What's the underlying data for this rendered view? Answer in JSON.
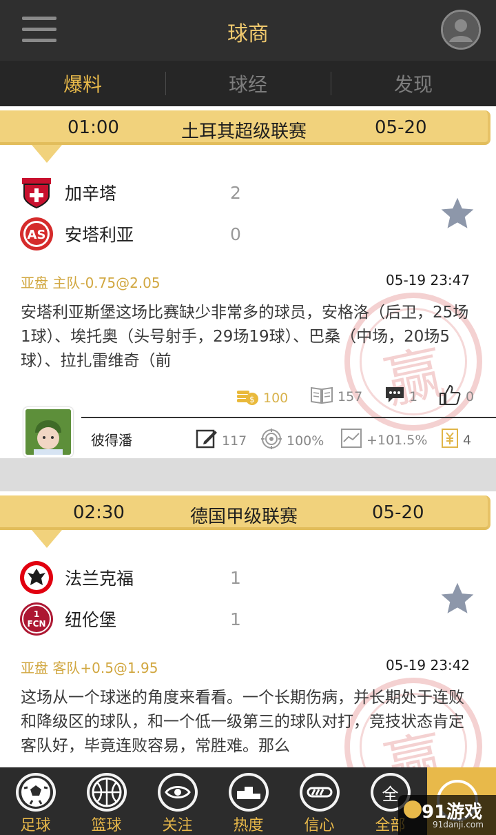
{
  "header": {
    "title": "球商"
  },
  "tabs": [
    {
      "label": "爆料",
      "active": true
    },
    {
      "label": "球经",
      "active": false
    },
    {
      "label": "发现",
      "active": false
    }
  ],
  "matches": [
    {
      "time": "01:00",
      "league": "土耳其超级联赛",
      "date": "05-20",
      "home": {
        "name": "加辛塔",
        "score": "2",
        "logo_color": "#c8102e"
      },
      "away": {
        "name": "安塔利亚",
        "score": "0",
        "logo_color": "#d52b2b"
      },
      "odds": "亚盘 主队-0.75@2.05",
      "post_time": "05-19 23:47",
      "description": "安塔利亚斯堡这场比赛缺少非常多的球员，安格洛（后卫，25场1球）、埃托奥（头号射手，29场19球）、巴桑（中场，20场5球）、拉扎雷维奇（前",
      "stamp_text": "赢",
      "stats": {
        "coins": "100",
        "reads": "157",
        "comments": "1",
        "likes": "0"
      },
      "author": {
        "name": "彼得潘",
        "posts": "117",
        "hit_rate": "100%",
        "profit": "+101.5%",
        "wins": "4"
      }
    },
    {
      "time": "02:30",
      "league": "德国甲级联赛",
      "date": "05-20",
      "home": {
        "name": "法兰克福",
        "score": "1",
        "logo_color": "#e1000f"
      },
      "away": {
        "name": "纽伦堡",
        "score": "1",
        "logo_color": "#ad1732"
      },
      "odds": "亚盘 客队+0.5@1.95",
      "post_time": "05-19 23:42",
      "description": "这场从一个球迷的角度来看看。一个长期伤病，并长期处于连败和降级区的球队，和一个低一级第三的球队对打，竞技状态肯定客队好，毕竟连败容易，常胜难。那么",
      "stamp_text": "赢"
    }
  ],
  "bottom_nav": [
    {
      "label": "足球",
      "icon": "soccer-ball-icon"
    },
    {
      "label": "篮球",
      "icon": "basketball-icon"
    },
    {
      "label": "关注",
      "icon": "eye-icon"
    },
    {
      "label": "热度",
      "icon": "podium-icon"
    },
    {
      "label": "信心",
      "icon": "progress-icon"
    },
    {
      "label": "全部",
      "icon": "all-icon",
      "glyph": "全"
    }
  ],
  "watermark": {
    "big": "91游戏",
    "small": "91danji.com"
  },
  "colors": {
    "gold": "#e8b94a",
    "dark": "#2f2f2f",
    "star": "#8d97aa"
  }
}
